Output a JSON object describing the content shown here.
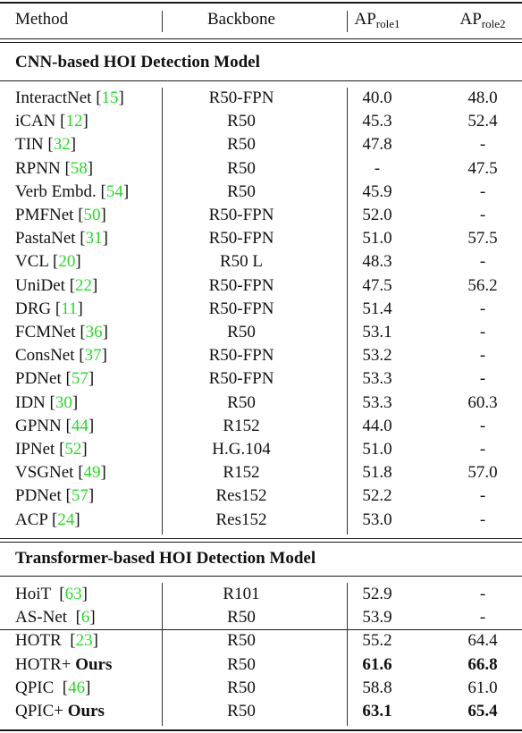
{
  "header": {
    "method": "Method",
    "backbone": "Backbone",
    "ap1_main": "AP",
    "ap1_sub": "role1",
    "ap2_main": "AP",
    "ap2_sub": "role2"
  },
  "colors": {
    "citation": "#22dd22",
    "text": "#111111"
  },
  "sections": [
    {
      "title": "CNN-based HOI Detection Model",
      "rows": [
        {
          "name": "InteractNet",
          "ref": "15",
          "backbone": "R50-FPN",
          "ap1": "40.0",
          "ap2": "48.0"
        },
        {
          "name": "iCAN",
          "ref": "12",
          "backbone": "R50",
          "ap1": "45.3",
          "ap2": "52.4"
        },
        {
          "name": "TIN",
          "ref": "32",
          "backbone": "R50",
          "ap1": "47.8",
          "ap2": "-"
        },
        {
          "name": "RPNN",
          "ref": "58",
          "backbone": "R50",
          "ap1": "-",
          "ap2": "47.5"
        },
        {
          "name": "Verb Embd.",
          "ref": "54",
          "backbone": "R50",
          "ap1": "45.9",
          "ap2": "-"
        },
        {
          "name": "PMFNet",
          "ref": "50",
          "backbone": "R50-FPN",
          "ap1": "52.0",
          "ap2": "-"
        },
        {
          "name": "PastaNet",
          "ref": "31",
          "backbone": "R50-FPN",
          "ap1": "51.0",
          "ap2": "57.5"
        },
        {
          "name": "VCL",
          "ref": "20",
          "backbone": "R50 L",
          "ap1": "48.3",
          "ap2": "-"
        },
        {
          "name": "UniDet",
          "ref": "22",
          "backbone": "R50-FPN",
          "ap1": "47.5",
          "ap2": "56.2"
        },
        {
          "name": "DRG",
          "ref": "11",
          "backbone": "R50-FPN",
          "ap1": "51.4",
          "ap2": "-"
        },
        {
          "name": "FCMNet",
          "ref": "36",
          "backbone": "R50",
          "ap1": "53.1",
          "ap2": "-"
        },
        {
          "name": "ConsNet",
          "ref": "37",
          "backbone": "R50-FPN",
          "ap1": "53.2",
          "ap2": "-"
        },
        {
          "name": "PDNet",
          "ref": "57",
          "backbone": "R50-FPN",
          "ap1": "53.3",
          "ap2": "-"
        },
        {
          "name": "IDN",
          "ref": "30",
          "backbone": "R50",
          "ap1": "53.3",
          "ap2": "60.3"
        },
        {
          "name": "GPNN",
          "ref": "44",
          "backbone": "R152",
          "ap1": "44.0",
          "ap2": "-"
        },
        {
          "name": "IPNet",
          "ref": "52",
          "backbone": "H.G.104",
          "ap1": "51.0",
          "ap2": "-"
        },
        {
          "name": "VSGNet",
          "ref": "49",
          "backbone": "R152",
          "ap1": "51.8",
          "ap2": "57.0"
        },
        {
          "name": "PDNet",
          "ref": "57",
          "backbone": "Res152",
          "ap1": "52.2",
          "ap2": "-"
        },
        {
          "name": "ACP",
          "ref": "24",
          "backbone": "Res152",
          "ap1": "53.0",
          "ap2": "-"
        }
      ]
    },
    {
      "title": "Transformer-based HOI Detection Model",
      "rows": [
        {
          "name": "HoiT ",
          "ref": "63",
          "backbone": "R101",
          "ap1": "52.9",
          "ap2": "-"
        },
        {
          "name": "AS-Net ",
          "ref": "6",
          "backbone": "R50",
          "ap1": "53.9",
          "ap2": "-"
        },
        {
          "name": "HOTR ",
          "ref": "23",
          "backbone": "R50",
          "ap1": "55.2",
          "ap2": "64.4"
        },
        {
          "name": "HOTR+ ",
          "ours": "Ours",
          "backbone": "R50",
          "ap1": "61.6",
          "ap2": "66.8",
          "bold": true
        },
        {
          "name": "QPIC ",
          "ref": "46",
          "backbone": "R50",
          "ap1": "58.8",
          "ap2": "61.0"
        },
        {
          "name": "QPIC+ ",
          "ours": "Ours",
          "backbone": "R50",
          "ap1": "63.1",
          "ap2": "65.4",
          "bold": true
        }
      ]
    }
  ]
}
